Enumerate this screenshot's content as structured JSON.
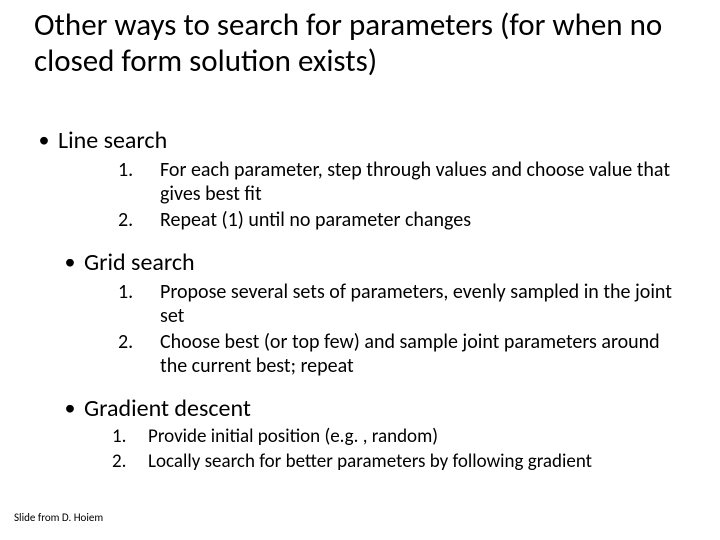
{
  "title": "Other ways to search for parameters (for when no closed form solution exists)",
  "sections": [
    {
      "heading": "Line search",
      "items": [
        "For each parameter, step through values and choose value that gives best fit",
        "Repeat (1) until no parameter changes"
      ]
    },
    {
      "heading": "Grid search",
      "items": [
        "Propose several sets of parameters, evenly sampled in the joint set",
        "Choose best (or top few) and sample joint parameters around the current best; repeat"
      ]
    },
    {
      "heading": "Gradient descent",
      "items": [
        "Provide initial position (e.g. , random)",
        "Locally search for better parameters by following gradient"
      ]
    }
  ],
  "num_labels": [
    "1.",
    "2."
  ],
  "bullet_char": "•",
  "credit": "Slide from D. Hoiem"
}
